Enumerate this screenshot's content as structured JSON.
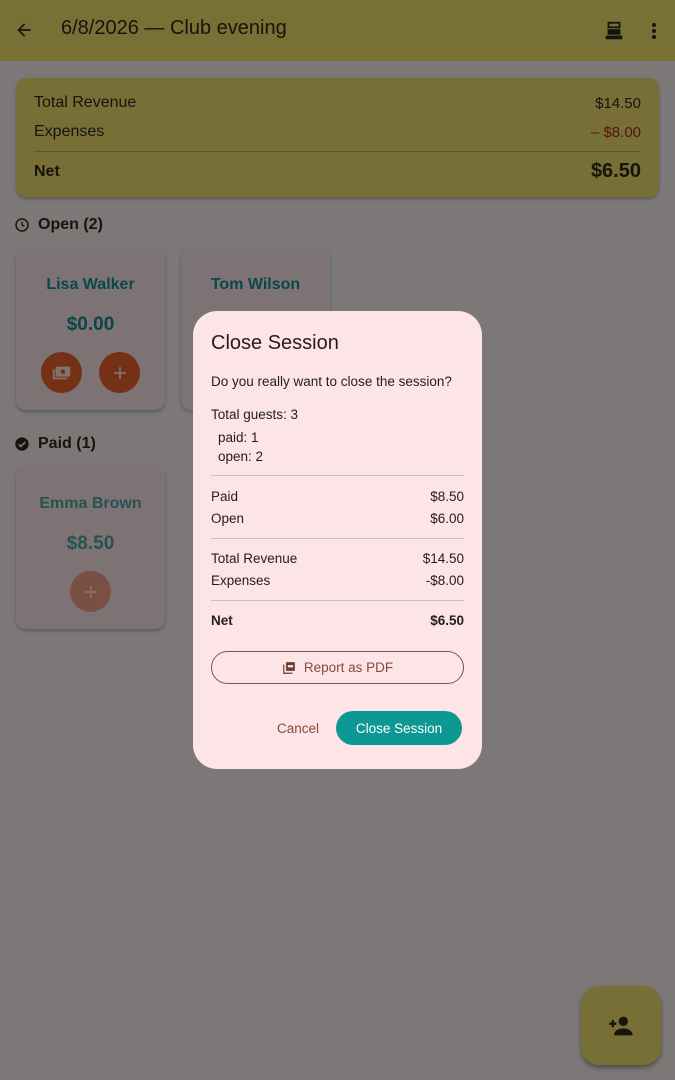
{
  "appbar": {
    "title": "6/8/2026 — Club evening",
    "back_icon": "arrow-back-icon",
    "register_icon": "cash-register-icon",
    "more_icon": "more-vert-icon"
  },
  "summary": {
    "revenue_label": "Total Revenue",
    "revenue_value": "$14.50",
    "expenses_label": "Expenses",
    "expenses_value": "– $8.00",
    "net_label": "Net",
    "net_value": "$6.50"
  },
  "sections": {
    "open_label": "Open (2)",
    "paid_label": "Paid (1)"
  },
  "guests": [
    {
      "name": "Lisa Walker",
      "amount": "$0.00"
    },
    {
      "name": "Tom Wilson",
      "amount": ""
    },
    {
      "name": "Emma Brown",
      "amount": "$8.50"
    }
  ],
  "dialog": {
    "title": "Close Session",
    "question": "Do you really want to close the session?",
    "total_guests": "Total guests: 3",
    "paid_count": "paid: 1",
    "open_count": "open: 2",
    "paid_label": "Paid",
    "paid_value": "$8.50",
    "open_label": "Open",
    "open_value": "$6.00",
    "revenue_label": "Total Revenue",
    "revenue_value": "$14.50",
    "expenses_label": "Expenses",
    "expenses_value": "-$8.00",
    "net_label": "Net",
    "net_value": "$6.50",
    "pdf_label": "Report as PDF",
    "cancel_label": "Cancel",
    "confirm_label": "Close Session"
  },
  "colors": {
    "appbar": "#f1e16a",
    "teal": "#13908e",
    "orange": "#e8622a",
    "expense_red": "#b3261e",
    "dialog_bg": "#fde4e7"
  }
}
